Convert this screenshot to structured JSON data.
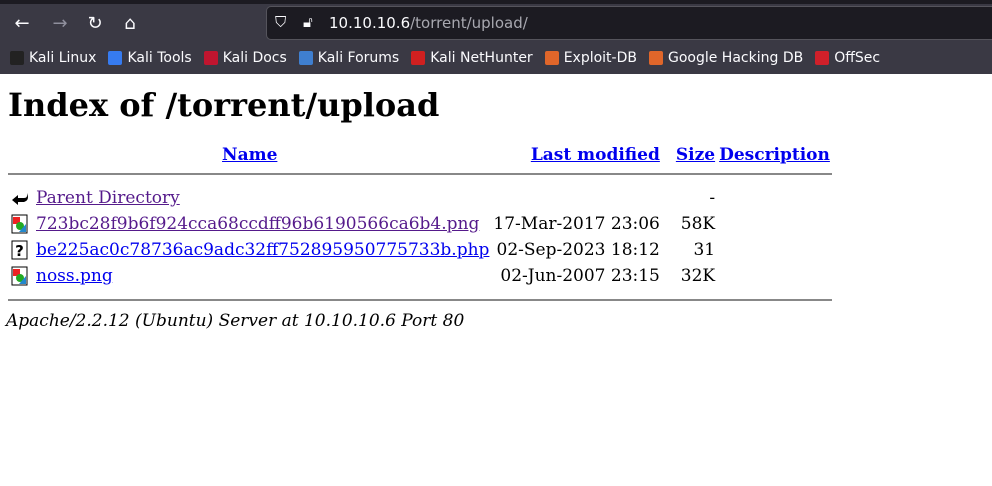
{
  "browser": {
    "url_host": "10.10.10.6",
    "url_path": "/torrent/upload/",
    "bookmarks": [
      {
        "label": "Kali Linux",
        "color": "#222222"
      },
      {
        "label": "Kali Tools",
        "color": "#367bf0"
      },
      {
        "label": "Kali Docs",
        "color": "#c0152f"
      },
      {
        "label": "Kali Forums",
        "color": "#3f7fd0"
      },
      {
        "label": "Kali NetHunter",
        "color": "#d02020"
      },
      {
        "label": "Exploit-DB",
        "color": "#e0662a"
      },
      {
        "label": "Google Hacking DB",
        "color": "#e0662a"
      },
      {
        "label": "OffSec",
        "color": "#d0202a"
      }
    ]
  },
  "page": {
    "title": "Index of /torrent/upload",
    "columns": {
      "name": "Name",
      "modified": "Last modified",
      "size": "Size",
      "description": "Description"
    },
    "rows": [
      {
        "icon": "back-icon",
        "name": "Parent Directory",
        "modified": "",
        "size": "-",
        "description": "",
        "visited": true
      },
      {
        "icon": "image-icon",
        "name": "723bc28f9b6f924cca68ccdff96b6190566ca6b4.png",
        "modified": "17-Mar-2017 23:06",
        "size": "58K",
        "description": "",
        "visited": true
      },
      {
        "icon": "unknown-file-icon",
        "name": "be225ac0c78736ac9adc32ff752895950775733b.php",
        "modified": "02-Sep-2023 18:12",
        "size": "31",
        "description": "",
        "visited": false
      },
      {
        "icon": "image-icon",
        "name": "noss.png",
        "modified": "02-Jun-2007 23:15",
        "size": "32K",
        "description": "",
        "visited": false
      }
    ],
    "footer": "Apache/2.2.12 (Ubuntu) Server at 10.10.10.6 Port 80"
  }
}
